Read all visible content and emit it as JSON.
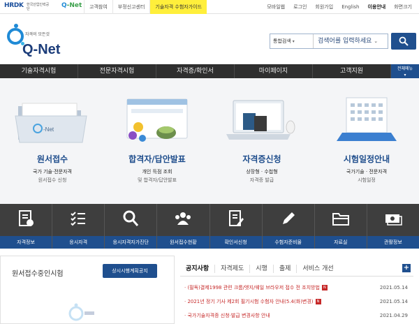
{
  "topbar": {
    "hrdk": "HRDK",
    "hrdk_sub": "한국산업인력공단",
    "qnet_mini_q": "Q",
    "qnet_mini_rest": "-Net",
    "links": [
      "고객참여",
      "부정신고센터",
      "기술자격 수험자가이드"
    ],
    "right_links": [
      "모바일웹",
      "로그인",
      "회원가입",
      "English",
      "이용안내",
      "화면크기"
    ]
  },
  "logo": {
    "tagline": "자격의 모든것",
    "word": "Q-Net"
  },
  "search": {
    "category": "통합검색",
    "placeholder": "검색어를 입력하세요"
  },
  "nav": {
    "items": [
      "기술자격시험",
      "전문자격시험",
      "자격증/확인서",
      "마이페이지",
      "고객지원"
    ],
    "all_menu": "전체메뉴"
  },
  "services": [
    {
      "title": "원서접수",
      "line1": "국가 기술·전문자격",
      "line2": "원서접수 신청"
    },
    {
      "title": "합격자/답안발표",
      "line1": "개인 득점 조회",
      "line2": "및 합격자/답안발표"
    },
    {
      "title": "자격증신청",
      "line1": "상장형 · 수첩형",
      "line2": "자격증 발급"
    },
    {
      "title": "시험일정안내",
      "line1": "국가기술 · 전문자격",
      "line2": "시험일정"
    }
  ],
  "quick_menu": [
    "자격정보",
    "응시자격",
    "응시자격자가진단",
    "원서접수현황",
    "확인서신청",
    "수험자준비물",
    "자료실",
    "관활정보"
  ],
  "left_panel": {
    "title": "원서접수중인시험",
    "button": "상시시행계획공지"
  },
  "notice": {
    "tabs": [
      "공지사항",
      "자격제도",
      "시행",
      "출제",
      "서비스 개선"
    ],
    "plus": "+",
    "new_badge": "N",
    "items": [
      {
        "text": "· (필독)결제1998 관련 크롬/엣지/웨일 브라우저 접수 전 조치방법",
        "date": "2021.05.14",
        "is_new": true
      },
      {
        "text": "· 2021년 정기 기사 제2회 필기시험 수험자 안내(5.4(화)변경)",
        "date": "2021.05.14",
        "is_new": true
      },
      {
        "text": "· 국가기술자격증 신청·발급 변경사항 안내",
        "date": "2021.04.29",
        "is_new": false
      }
    ]
  }
}
